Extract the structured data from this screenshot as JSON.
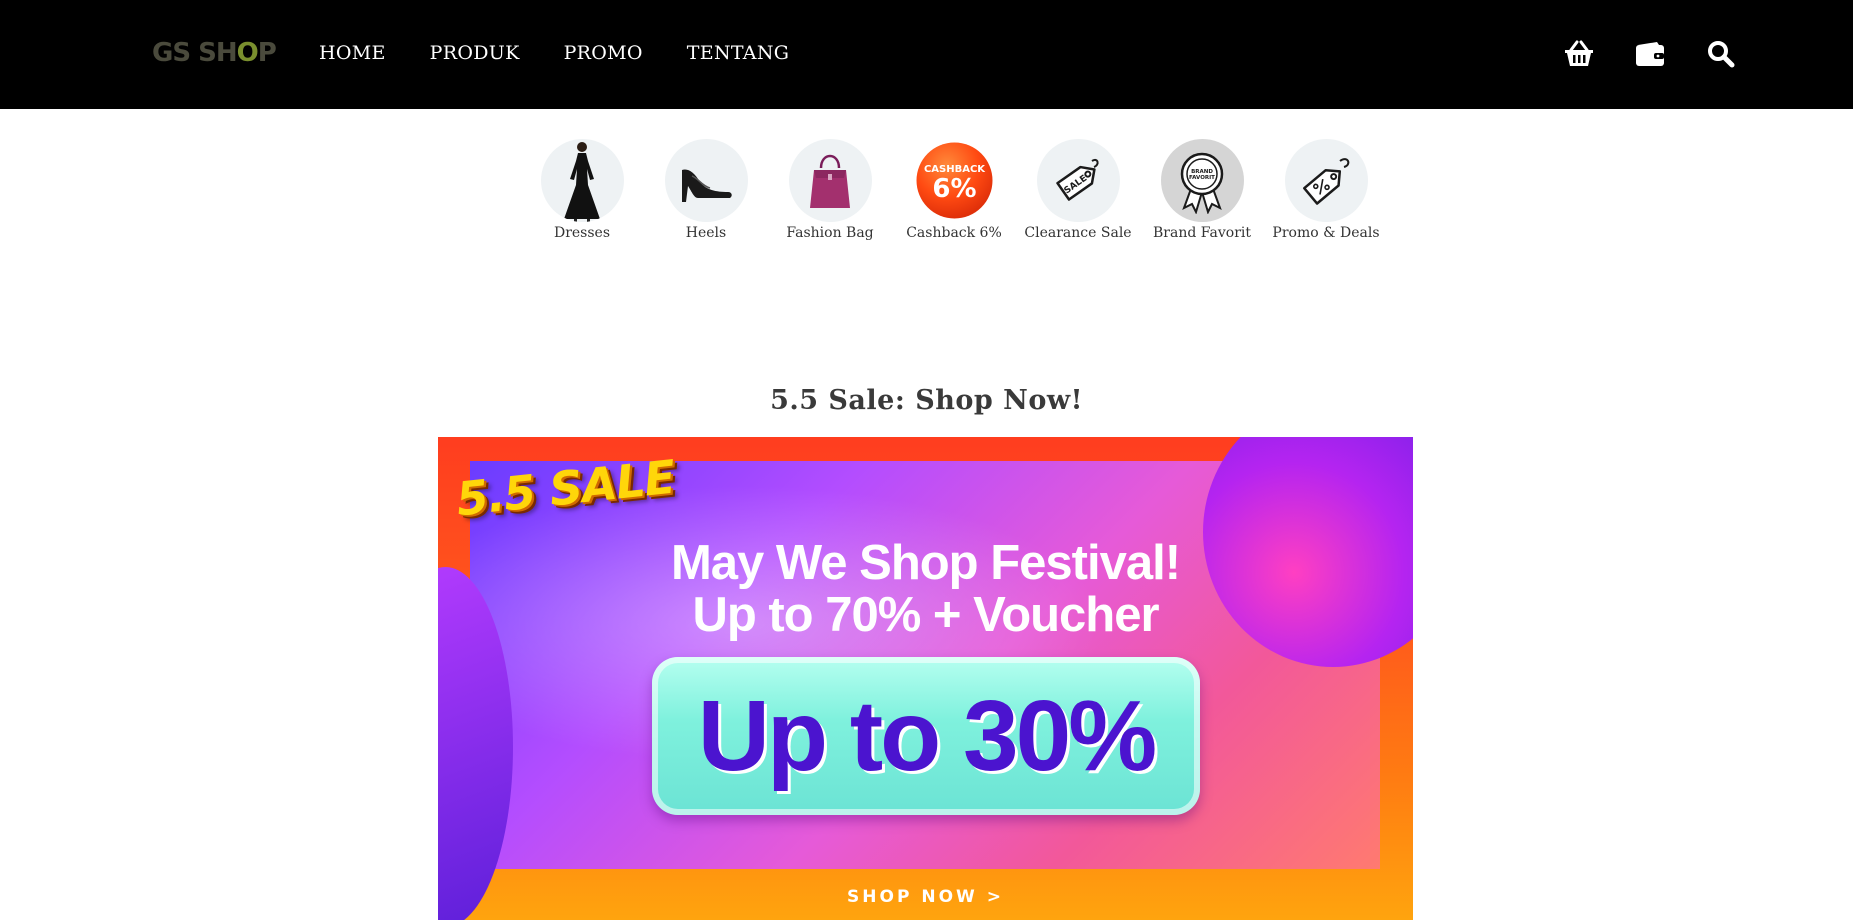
{
  "header": {
    "logo": {
      "part1": "GS SH",
      "o": "O",
      "part2": "P"
    },
    "nav": [
      "HOME",
      "PRODUK",
      "PROMO",
      "TENTANG"
    ],
    "icons": [
      "basket-icon",
      "wallet-icon",
      "search-icon"
    ]
  },
  "categories": [
    {
      "label": "Dresses",
      "icon": "dress-icon"
    },
    {
      "label": "Heels",
      "icon": "heels-icon"
    },
    {
      "label": "Fashion Bag",
      "icon": "bag-icon"
    },
    {
      "label": "Cashback 6%",
      "icon": "cashback-icon",
      "badge_top": "CASHBACK",
      "badge_value": "6%"
    },
    {
      "label": "Clearance Sale",
      "icon": "sale-tag-icon",
      "tag_text": "SALE"
    },
    {
      "label": "Brand Favorit",
      "icon": "award-ribbon-icon",
      "badge_text": "BRAND FAVORIT"
    },
    {
      "label": "Promo & Deals",
      "icon": "percent-tag-icon"
    }
  ],
  "section": {
    "title": "5.5 Sale: Shop Now!"
  },
  "banner": {
    "sale_tag": "5.5 SALE",
    "headline_1": "May We Shop Festival!",
    "headline_2": "Up to 70% + Voucher",
    "pill": "Up to 30%",
    "cta": "SHOP NOW >"
  },
  "colors": {
    "header_bg": "#000000",
    "logo_text": "#4a4a3c",
    "logo_accent": "#7a8f2e",
    "banner_orange": "#ff5a1c",
    "banner_purple": "#6a3cff",
    "pill_mint": "#7ff1dd",
    "pill_text": "#4b14cf"
  }
}
